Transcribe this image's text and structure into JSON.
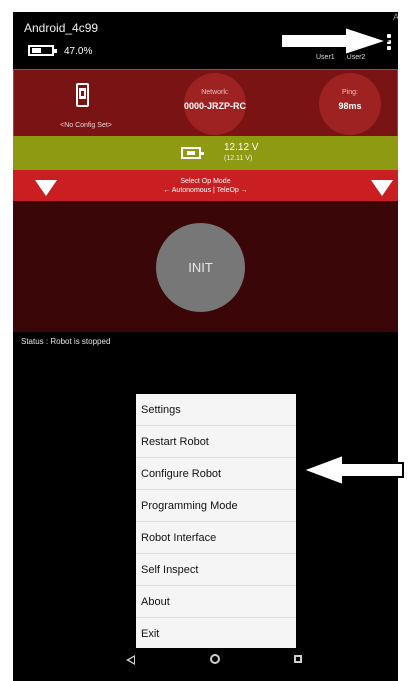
{
  "status_bar": {
    "device_name": "Android_4c99",
    "battery_percent": "47.0%",
    "user_labels": [
      "User1",
      "User2"
    ],
    "corner_glyph": "A"
  },
  "robot": {
    "config_text": "<No Config Set>",
    "network_label": "Network:",
    "network_value": "0000-JRZP-RC",
    "ping_label": "Ping:",
    "ping_value": "98ms"
  },
  "voltage": {
    "main": "12.12 V",
    "sub": "(12.11 V)"
  },
  "opmode": {
    "title": "Select Op Mode",
    "subtitle": "← Autonomous | TeleOp →"
  },
  "init_label": "INIT",
  "status_text": "Status : Robot is stopped",
  "menu": {
    "items": [
      {
        "label": "Settings"
      },
      {
        "label": "Restart Robot"
      },
      {
        "label": "Configure Robot"
      },
      {
        "label": "Programming Mode"
      },
      {
        "label": "Robot Interface"
      },
      {
        "label": "Self Inspect"
      },
      {
        "label": "About"
      },
      {
        "label": "Exit"
      }
    ]
  },
  "navbar": {
    "icons": [
      "back-icon",
      "home-icon",
      "recent-apps-icon"
    ]
  },
  "annotations": [
    "arrow pointing to overflow menu",
    "arrow pointing to Configure Robot"
  ],
  "colors": {
    "robot_panel": "#7a1414",
    "voltage_bar": "#8d9a12",
    "opmode_bar": "#c91f22",
    "control_area": "#3a0607",
    "menu_bg": "#f5f5f5"
  }
}
